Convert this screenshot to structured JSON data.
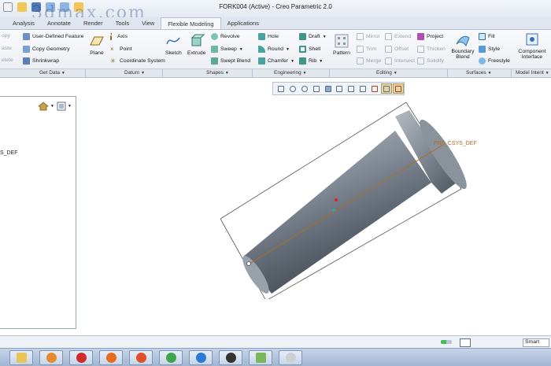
{
  "window": {
    "title": "FORK004 (Active) - Creo Parametric 2.0",
    "watermark": "3dmax.com"
  },
  "tabs": [
    "Analysis",
    "Annotate",
    "Render",
    "Tools",
    "View",
    "Flexible Modeling",
    "Applications"
  ],
  "ribbon": {
    "get_data": {
      "items": [
        "User-Defined Feature",
        "Copy Geometry",
        "Shrinkwrap"
      ],
      "dim_items": [
        "opy",
        "aste",
        "elete"
      ]
    },
    "datum": {
      "plane": "Plane",
      "items": [
        "Axis",
        "Point",
        "Coordinate System"
      ]
    },
    "shapes": {
      "sketch": "Sketch",
      "extrude": "Extrude",
      "items": [
        "Revolve",
        "Sweep",
        "Swept Blend"
      ]
    },
    "engineering": {
      "items": [
        "Hole",
        "Round",
        "Chamfer",
        "Draft",
        "Shell",
        "Rib"
      ]
    },
    "editing": {
      "pattern": "Pattern",
      "dim_items": [
        "Mirror",
        "Trim",
        "Merge",
        "Extend",
        "Offset",
        "Intersect",
        "Thicken",
        "Solidify"
      ],
      "project": "Project"
    },
    "surfaces": {
      "boundary": "Boundary Blend",
      "items": [
        "Fill",
        "Style",
        "Freestyle"
      ]
    },
    "model_intent": {
      "component": "Component Interface"
    }
  },
  "groups": [
    "Get Data",
    "Datum",
    "Shapes",
    "Engineering",
    "Editing",
    "Surfaces",
    "Model Intent"
  ],
  "model_tree": {
    "visible_text": "S_DEF"
  },
  "viewport": {
    "csys_label": "PRT_CSYS_DEF"
  },
  "status": {
    "filter": "Smart"
  },
  "colors": {
    "accent": "#b06c24",
    "part_dark": "#4e5761",
    "part_light": "#c9cfd5"
  }
}
